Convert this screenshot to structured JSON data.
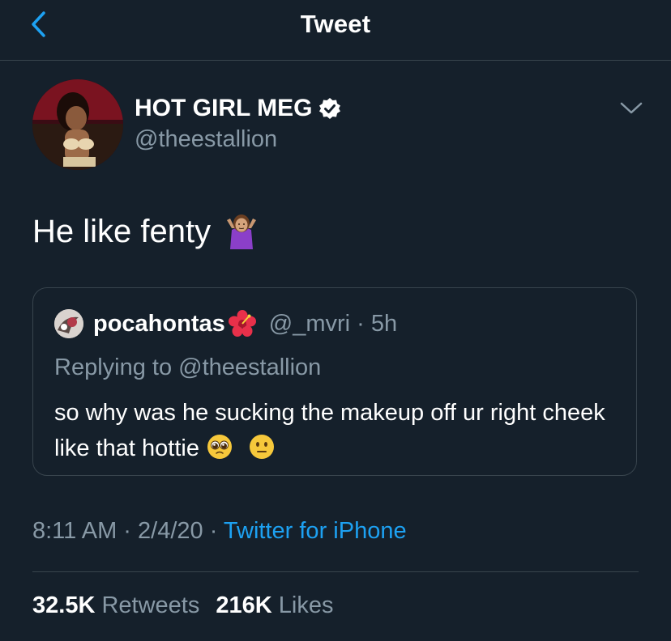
{
  "header": {
    "title": "Tweet"
  },
  "tweet": {
    "author_name": "HOT GIRL MEG",
    "author_handle": "@theestallion",
    "text": "He like fenty",
    "timestamp": "8:11 AM · 2/4/20 ·",
    "source": "Twitter for iPhone"
  },
  "quote": {
    "author_name": "pocahontas",
    "handle_time": "@_mvri · 5h",
    "replying_to": "Replying to @theestallion",
    "text": "so why was he sucking the makeup off ur right cheek like that hottie"
  },
  "stats": {
    "retweets_count": "32.5K",
    "retweets_label": "Retweets",
    "likes_count": "216K",
    "likes_label": "Likes"
  },
  "colors": {
    "background": "#15202b",
    "accent": "#1da1f2",
    "secondary_text": "#8899a6",
    "border": "#38444d"
  },
  "icons": [
    "back-icon",
    "verified-icon",
    "chevron-down-icon",
    "shrug-emoji-icon",
    "hibiscus-emoji-icon",
    "pleading-emoji-icon",
    "neutral-face-emoji-icon"
  ]
}
